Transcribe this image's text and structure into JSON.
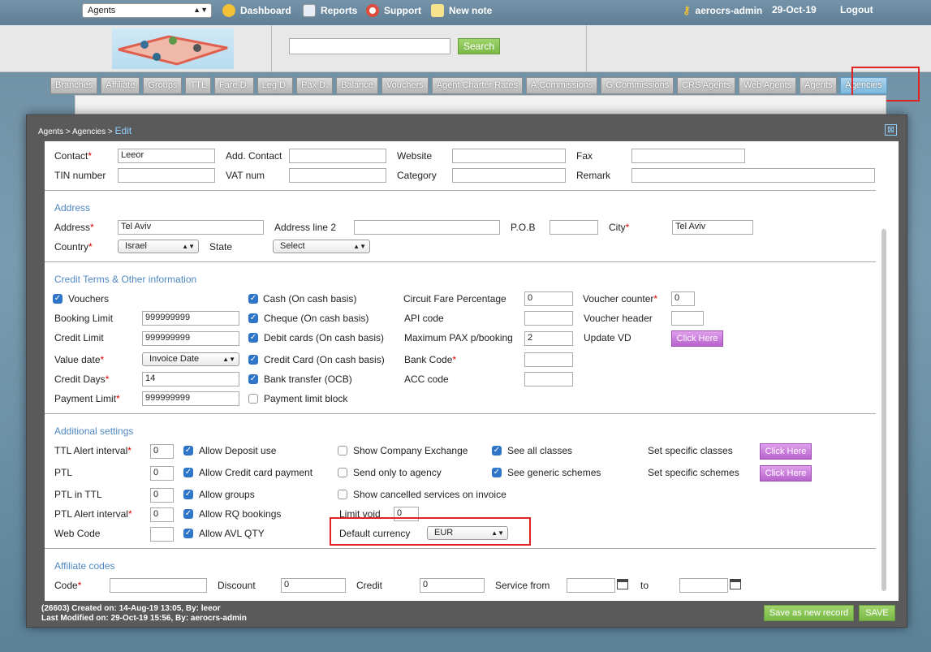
{
  "topbar": {
    "module_select": "Agents",
    "links": [
      "Dashboard",
      "Reports",
      "Support",
      "New note"
    ],
    "user": "aerocrs-admin",
    "date": "29-Oct-19",
    "logout": "Logout"
  },
  "header": {
    "search_button": "Search",
    "search_value": ""
  },
  "tabs": [
    "Branches",
    "Affiliate",
    "Groups",
    "TTL",
    "Fare D.",
    "Leg D.",
    "Pax D.",
    "Balance",
    "Vouchers",
    "Agent Charter Rates",
    "A.Commissions",
    "G.Commissions",
    "CRS Agents",
    "Web Agents",
    "Agents",
    "Agencies"
  ],
  "active_tab": "Agencies",
  "dialog": {
    "breadcrumb": "Agents > Agencies > ",
    "breadcrumb_current": "Edit",
    "close": "⊠"
  },
  "contact": {
    "contact_label": "Contact",
    "contact_value": "Leeor",
    "add_contact_label": "Add. Contact",
    "website_label": "Website",
    "fax_label": "Fax",
    "tin_label": "TIN number",
    "vat_label": "VAT num",
    "category_label": "Category",
    "remark_label": "Remark"
  },
  "address": {
    "title": "Address",
    "address_label": "Address",
    "address_value": "Tel Aviv",
    "line2_label": "Address line 2",
    "pob_label": "P.O.B",
    "city_label": "City",
    "city_value": "Tel Aviv",
    "country_label": "Country",
    "country_value": "Israel",
    "state_label": "State",
    "state_value": "Select"
  },
  "credit": {
    "title": "Credit Terms & Other information",
    "vouchers": "Vouchers",
    "booking_limit_label": "Booking Limit",
    "booking_limit_value": "999999999",
    "credit_limit_label": "Credit Limit",
    "credit_limit_value": "999999999",
    "value_date_label": "Value date",
    "value_date_value": "Invoice Date",
    "credit_days_label": "Credit Days",
    "credit_days_value": "14",
    "payment_limit_label": "Payment Limit",
    "payment_limit_value": "999999999",
    "cash": "Cash (On cash basis)",
    "cheque": "Cheque (On cash basis)",
    "debit": "Debit cards (On cash basis)",
    "credit_card": "Credit Card (On cash basis)",
    "bank_transfer": "Bank transfer (OCB)",
    "payment_limit_block": "Payment limit block",
    "circuit_label": "Circuit Fare Percentage",
    "circuit_value": "0",
    "api_label": "API code",
    "max_pax_label": "Maximum PAX p/booking",
    "max_pax_value": "2",
    "bank_code_label": "Bank Code",
    "acc_label": "ACC code",
    "voucher_counter_label": "Voucher counter",
    "voucher_counter_value": "0",
    "voucher_header_label": "Voucher header",
    "update_vd_label": "Update VD",
    "click_here": "Click Here"
  },
  "additional": {
    "title": "Additional settings",
    "ttl_alert_label": "TTL Alert interval",
    "ttl_alert_value": "0",
    "ptl_label": "PTL",
    "ptl_value": "0",
    "ptl_in_ttl_label": "PTL in TTL",
    "ptl_in_ttl_value": "0",
    "ptl_alert_label": "PTL Alert interval",
    "ptl_alert_value": "0",
    "web_code_label": "Web Code",
    "allow_deposit": "Allow Deposit use",
    "allow_cc": "Allow Credit card payment",
    "allow_groups": "Allow groups",
    "allow_rq": "Allow RQ bookings",
    "allow_avl": "Allow AVL QTY",
    "show_exchange": "Show Company Exchange",
    "send_only": "Send only to agency",
    "show_cancelled": "Show cancelled services on invoice",
    "limit_void_label": "Limit void",
    "limit_void_value": "0",
    "default_currency_label": "Default currency",
    "default_currency_value": "EUR",
    "see_all": "See all classes",
    "see_generic": "See generic schemes",
    "set_classes": "Set specific classes",
    "set_schemes": "Set specific schemes",
    "click_here": "Click Here"
  },
  "affiliate": {
    "title": "Affiliate codes",
    "code_label": "Code",
    "discount_label": "Discount",
    "discount_value": "0",
    "credit_label": "Credit",
    "credit_value": "0",
    "service_from_label": "Service from",
    "to_label": "to"
  },
  "footer": {
    "created": "(26603) Created on: 14-Aug-19 13:05, By: leeor",
    "modified": "Last Modified on: 29-Oct-19 15:56, By: aerocrs-admin",
    "save_new": "Save as new record",
    "save": "SAVE"
  },
  "colors": {
    "accent": "#4f87c2",
    "highlight": "#e02323",
    "purple_button": "#b763cc",
    "green_button": "#7ab947"
  }
}
